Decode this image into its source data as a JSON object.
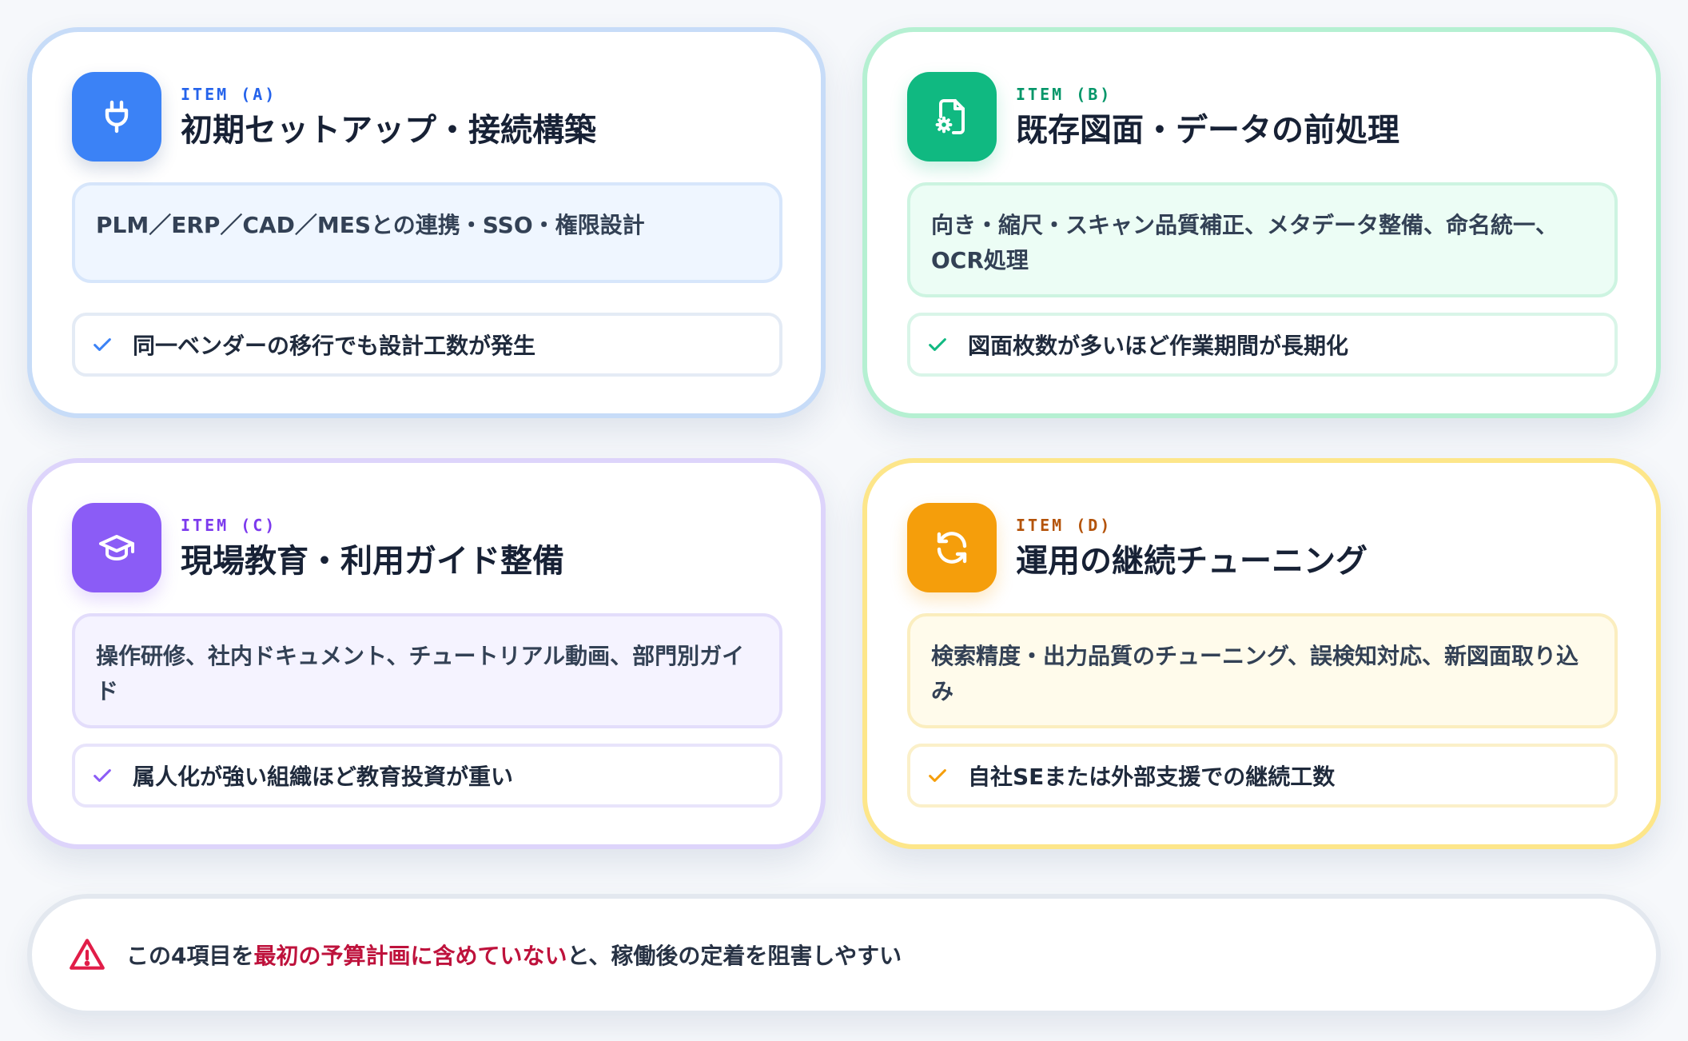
{
  "cards": [
    {
      "id": "a",
      "icon": "plug-icon",
      "item_label": "ITEM (A)",
      "title": "初期セットアップ・接続構築",
      "description": "PLM／ERP／CAD／MESとの連携・SSO・権限設計",
      "note": "同一ベンダーの移行でも設計工数が発生",
      "accent": "#3b82f6"
    },
    {
      "id": "b",
      "icon": "file-gear-icon",
      "item_label": "ITEM (B)",
      "title": "既存図面・データの前処理",
      "description": "向き・縮尺・スキャン品質補正、メタデータ整備、命名統一、OCR処理",
      "note": "図面枚数が多いほど作業期間が長期化",
      "accent": "#10b981"
    },
    {
      "id": "c",
      "icon": "graduation-cap-icon",
      "item_label": "ITEM (C)",
      "title": "現場教育・利用ガイド整備",
      "description": "操作研修、社内ドキュメント、チュートリアル動画、部門別ガイド",
      "note": "属人化が強い組織ほど教育投資が重い",
      "accent": "#8b5cf6"
    },
    {
      "id": "d",
      "icon": "refresh-icon",
      "item_label": "ITEM (D)",
      "title": "運用の継続チューニング",
      "description": "検索精度・出力品質のチューニング、誤検知対応、新図面取り込み",
      "note": "自社SEまたは外部支援での継続工数",
      "accent": "#f59e0b"
    }
  ],
  "alert": {
    "icon": "warning-triangle-icon",
    "text_before": "この4項目を",
    "text_highlight": "最初の予算計画に含めていない",
    "text_after": "と、稼働後の定着を阻害しやすい",
    "highlight_color": "#be123c"
  }
}
